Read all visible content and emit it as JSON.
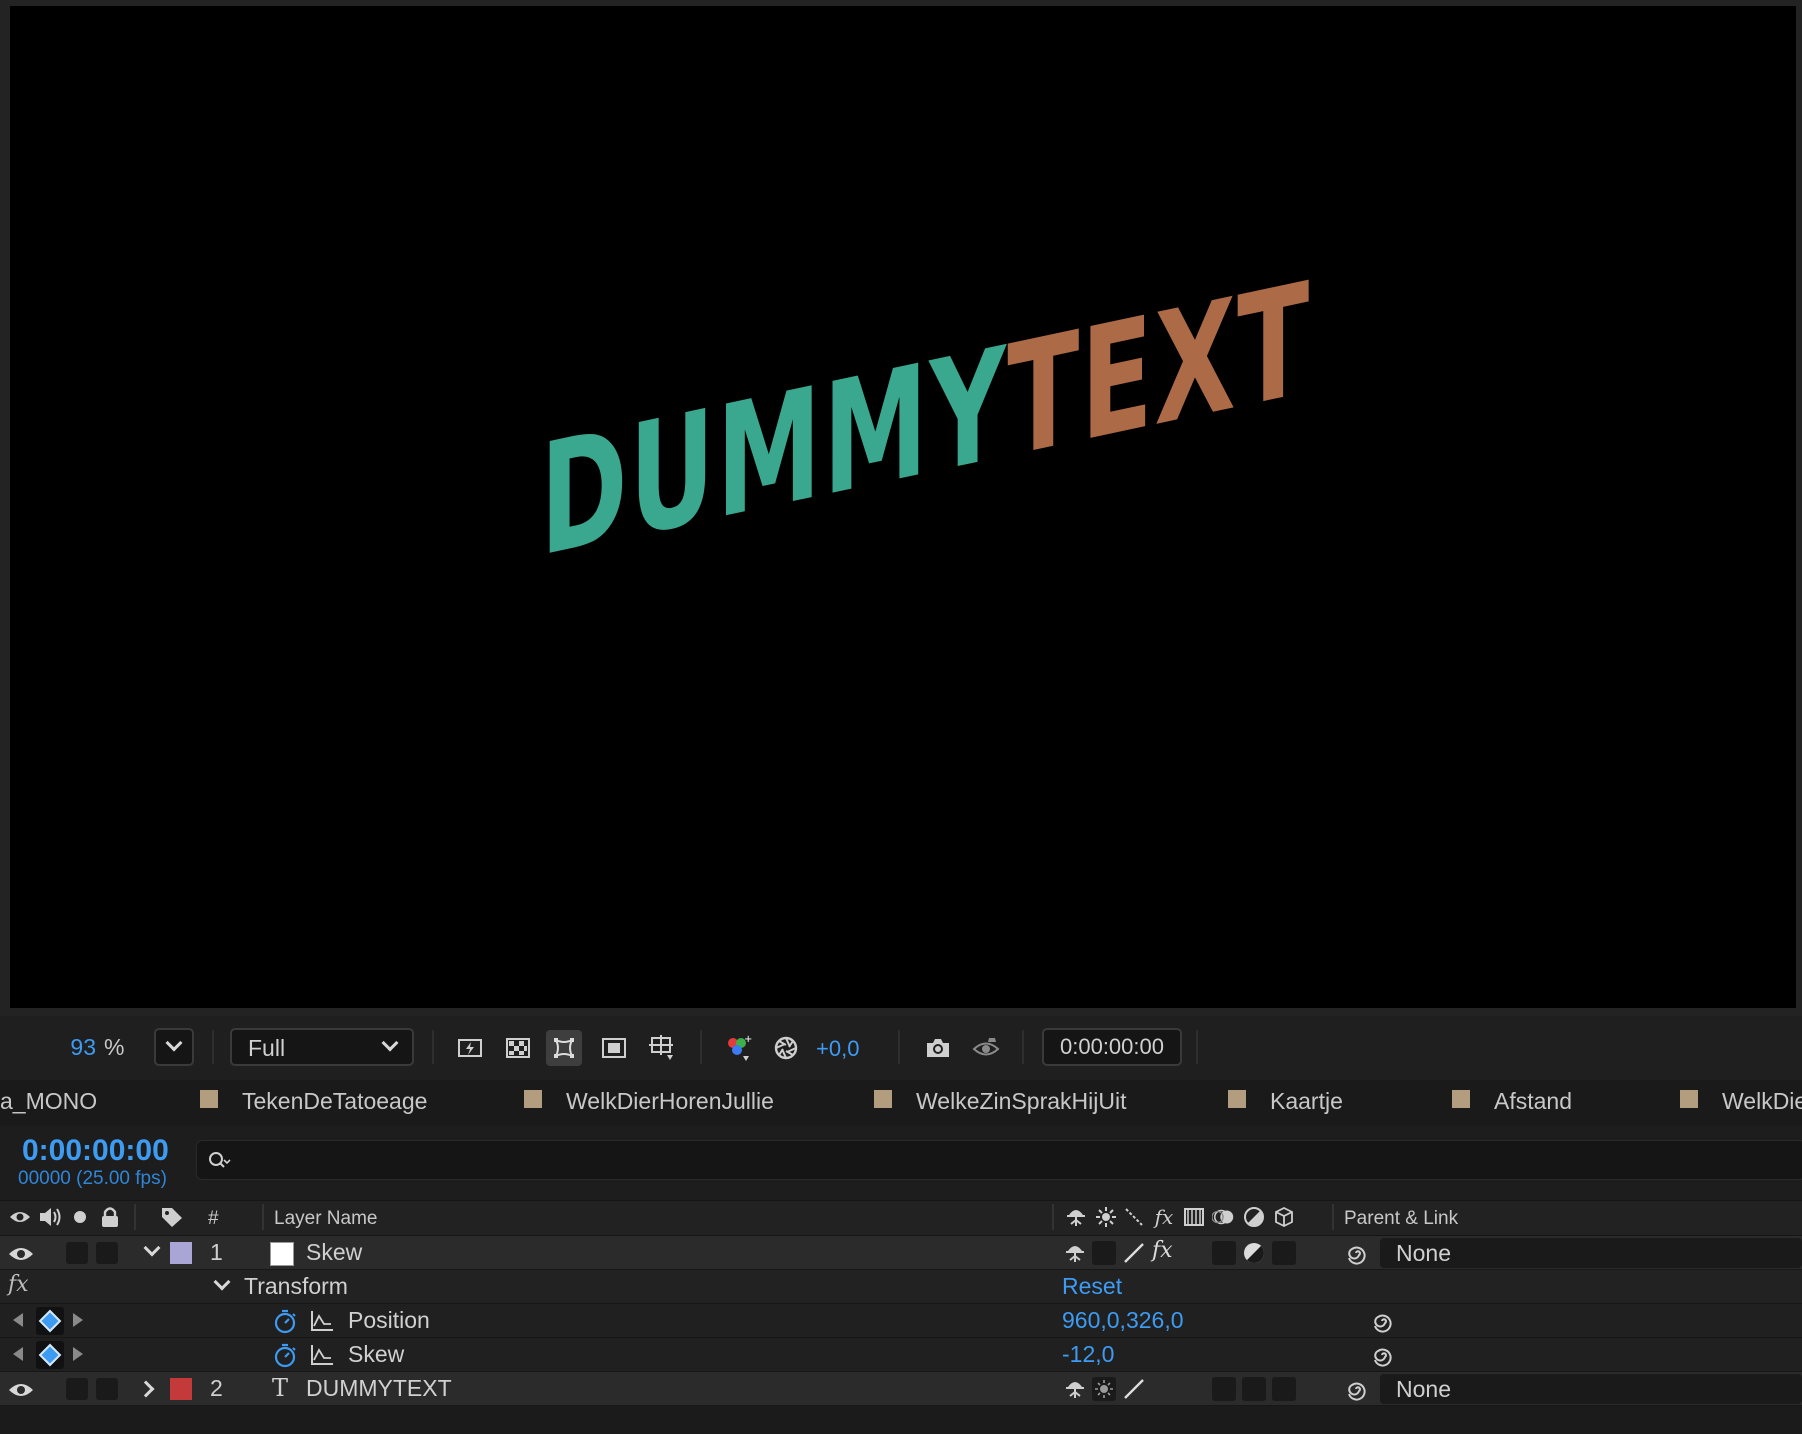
{
  "viewer": {
    "comp_text_part1": "DUMMY",
    "comp_text_part2": "TEXT",
    "color_part1": "#3aa88e",
    "color_part2": "#ad6a47"
  },
  "toolbar": {
    "zoom_value": "93",
    "zoom_unit": "%",
    "resolution": "Full",
    "exposure": "+0,0",
    "timecode": "0:00:00:00"
  },
  "tabs": [
    {
      "label": "a_MONO",
      "swatch": false
    },
    {
      "label": "TekenDeTatoeage",
      "swatch": true
    },
    {
      "label": "WelkDierHorenJullie",
      "swatch": true
    },
    {
      "label": "WelkeZinSprakHijUit",
      "swatch": true
    },
    {
      "label": "Kaartje",
      "swatch": true
    },
    {
      "label": "Afstand",
      "swatch": true
    },
    {
      "label": "WelkDie",
      "swatch": true
    }
  ],
  "timeline": {
    "current_time": "0:00:00:00",
    "frame_info": "00000 (25.00 fps)",
    "search_placeholder": ""
  },
  "columns": {
    "number": "#",
    "layer_name": "Layer Name",
    "parent_link": "Parent & Link"
  },
  "layers": [
    {
      "number": "1",
      "name": "Skew",
      "label_color": "#a9a6d6",
      "parent": "None",
      "expanded": true,
      "transform_group": "Transform",
      "transform_reset": "Reset",
      "properties": [
        {
          "name": "Position",
          "value": "960,0,326,0"
        },
        {
          "name": "Skew",
          "value": "-12,0"
        }
      ]
    },
    {
      "number": "2",
      "name": "DUMMYTEXT",
      "type_icon": "T",
      "label_color": "#c43a3a",
      "parent": "None",
      "expanded": false
    }
  ],
  "icons": {
    "fx_label": "fx"
  }
}
